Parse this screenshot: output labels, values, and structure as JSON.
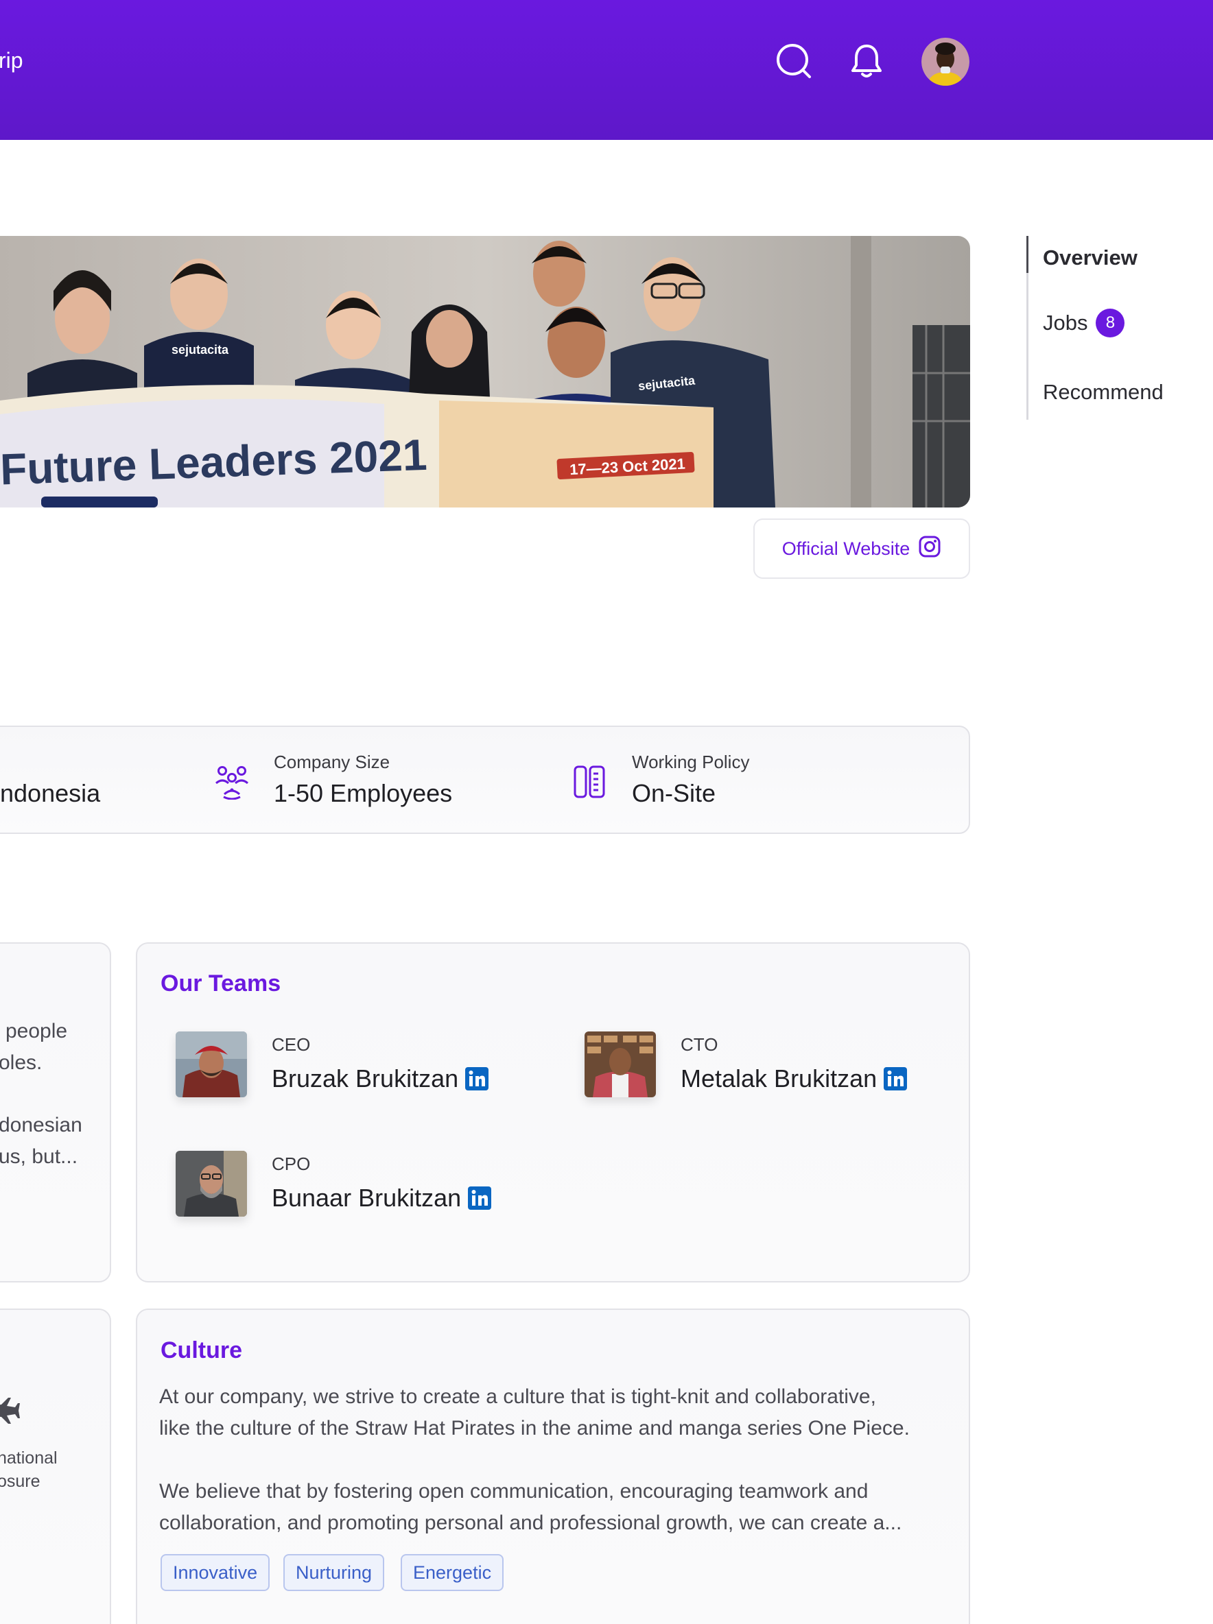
{
  "header": {
    "nav_fragment": "rip",
    "icons": [
      "search-icon",
      "bell-icon"
    ]
  },
  "hero": {
    "banner_text": "Future Leaders 2021",
    "date_text": "17—23 Oct 2021",
    "shirt_text": "sejutacita"
  },
  "official_website": {
    "label": "Official Website",
    "icon": "instagram-icon"
  },
  "side_nav": {
    "items": [
      {
        "label": "Overview"
      },
      {
        "label": "Jobs",
        "badge": "8"
      },
      {
        "label": "Recommend"
      }
    ]
  },
  "info": {
    "location_value": "ndonesia",
    "company_size": {
      "label": "Company Size",
      "value": "1-50 Employees"
    },
    "working_policy": {
      "label": "Working Policy",
      "value": "On-Site"
    }
  },
  "about_fragment": {
    "lines": [
      "people",
      "oles.",
      "donesian",
      "us, but..."
    ]
  },
  "teams": {
    "title": "Our Teams",
    "members": [
      {
        "role": "CEO",
        "name": "Bruzak Brukitzan"
      },
      {
        "role": "CTO",
        "name": "Metalak Brukitzan"
      },
      {
        "role": "CPO",
        "name": "Bunaar Brukitzan"
      }
    ]
  },
  "benefit_fragment": {
    "lines": [
      "national",
      "osure"
    ]
  },
  "culture": {
    "title": "Culture",
    "para1_line1": "At our company, we strive to create a culture that is tight-knit and collaborative,",
    "para1_line2": "like the culture of the Straw Hat Pirates in the anime and manga series One Piece.",
    "para2_line1": "We believe that by fostering open communication, encouraging teamwork and",
    "para2_line2": "collaboration, and promoting personal and professional growth, we can create a...",
    "tags": [
      "Innovative",
      "Nurturing",
      "Energetic"
    ]
  },
  "colors": {
    "brand": "#6a19df",
    "tag_text": "#3a5fc8",
    "linkedin": "#0a66c2"
  }
}
